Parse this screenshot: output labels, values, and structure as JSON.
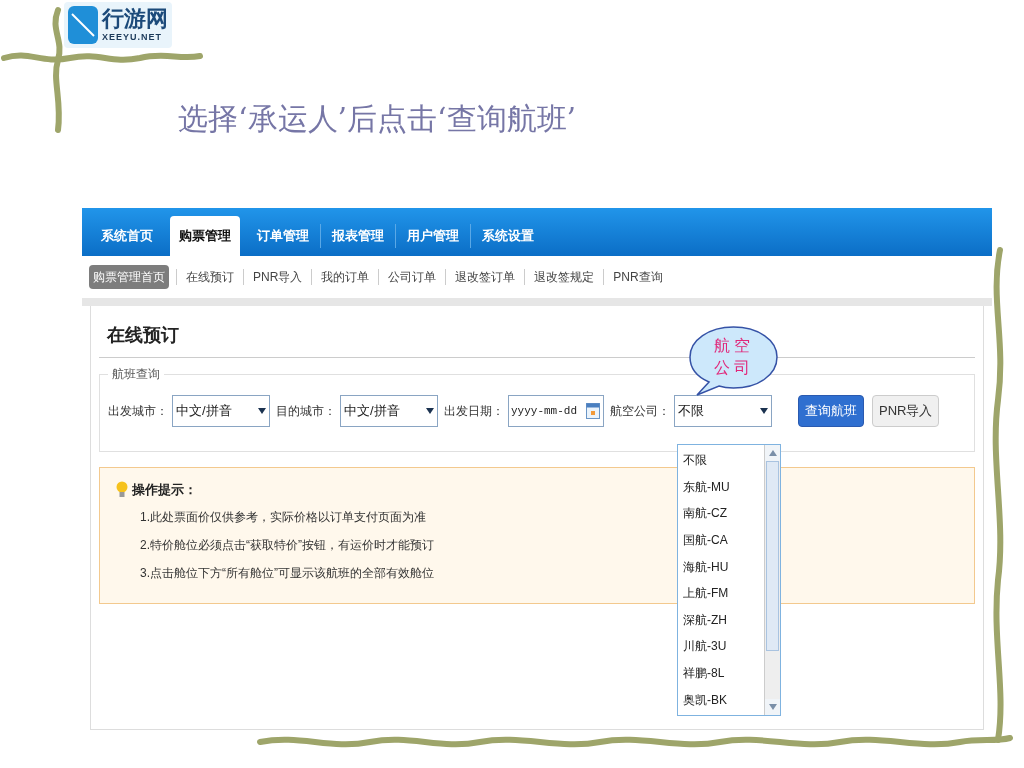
{
  "logo": {
    "name": "行游网",
    "domain": "XEEYU.NET"
  },
  "slide_title": "选择‘承运人’后点击‘查询航班’",
  "nav": {
    "tabs": [
      {
        "label": "系统首页",
        "selected": false
      },
      {
        "label": "购票管理",
        "selected": true
      },
      {
        "label": "订单管理",
        "selected": false
      },
      {
        "label": "报表管理",
        "selected": false
      },
      {
        "label": "用户管理",
        "selected": false
      },
      {
        "label": "系统设置",
        "selected": false
      }
    ]
  },
  "subnav": {
    "items": [
      {
        "label": "购票管理首页",
        "selected": true
      },
      {
        "label": "在线预订",
        "selected": false
      },
      {
        "label": "PNR导入",
        "selected": false
      },
      {
        "label": "我的订单",
        "selected": false
      },
      {
        "label": "公司订单",
        "selected": false
      },
      {
        "label": "退改签订单",
        "selected": false
      },
      {
        "label": "退改签规定",
        "selected": false
      },
      {
        "label": "PNR查询",
        "selected": false
      }
    ]
  },
  "page_title": "在线预订",
  "search": {
    "legend": "航班查询",
    "fields": [
      {
        "kind": "select",
        "label": "出发城市：",
        "value": "中文/拼音"
      },
      {
        "kind": "select",
        "label": "目的城市：",
        "value": "中文/拼音"
      },
      {
        "kind": "date",
        "label": "出发日期：",
        "placeholder": "yyyy-mm-dd"
      },
      {
        "kind": "select",
        "label": "航空公司：",
        "value": "不限"
      }
    ],
    "buttons": [
      {
        "label": "查询航班",
        "kind": "primary"
      },
      {
        "label": "PNR导入",
        "kind": "secondary"
      }
    ]
  },
  "callout": {
    "lines": [
      "航空",
      "公司"
    ]
  },
  "tips": {
    "title": "操作提示：",
    "items": [
      "1.此处票面价仅供参考，实际价格以订单支付页面为准",
      "2.特价舱位必须点击“获取特价”按钮，有运价时才能预订",
      "3.点击舱位下方“所有舱位”可显示该航班的全部有效舱位"
    ]
  },
  "airline_dropdown": {
    "options": [
      "不限",
      "东航-MU",
      "南航-CZ",
      "国航-CA",
      "海航-HU",
      "上航-FM",
      "深航-ZH",
      "川航-3U",
      "祥鹏-8L",
      "奥凯-BK"
    ]
  }
}
